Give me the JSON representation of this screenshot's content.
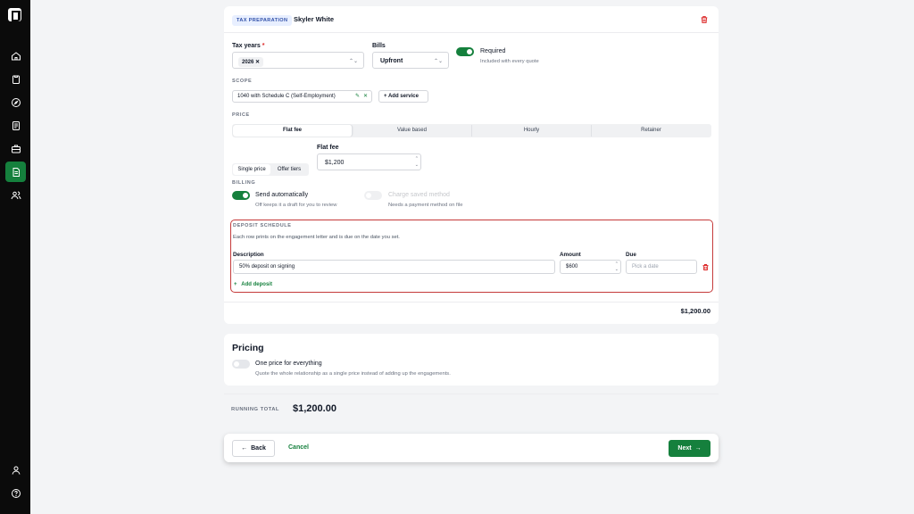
{
  "nav": {
    "items": [
      {
        "icon": "home-icon"
      },
      {
        "icon": "clipboard-icon"
      },
      {
        "icon": "compass-icon"
      },
      {
        "icon": "document-list-icon"
      },
      {
        "icon": "briefcase-icon"
      },
      {
        "icon": "proposal-document-icon",
        "active": true
      },
      {
        "icon": "users-icon"
      }
    ],
    "bottom": [
      {
        "icon": "user-icon"
      },
      {
        "icon": "help-icon"
      }
    ]
  },
  "engagement": {
    "badge": "TAX PREPARATION",
    "client": "Skyler White",
    "tax_years_label": "Tax years",
    "tax_years_required": "*",
    "tax_year_chip": "2026",
    "bills_label": "Bills",
    "bills_value": "Upfront",
    "required_label": "Required",
    "required_sub": "Included with every quote",
    "scope_label": "SCOPE",
    "scope_service": "1040 with Schedule C (Self-Employment)",
    "add_service": "Add service",
    "price_label": "PRICE",
    "price_tabs": [
      "Flat fee",
      "Value based",
      "Hourly",
      "Retainer"
    ],
    "price_tab_active": "Flat fee",
    "price_mode": [
      "Single price",
      "Offer tiers"
    ],
    "flat_fee_label": "Flat fee",
    "flat_fee_value": "$1,200",
    "billing_label": "BILLING",
    "send_auto_label": "Send automatically",
    "send_auto_sub": "Off keeps it a draft for you to review",
    "charge_label": "Charge saved method",
    "charge_sub": "Needs a payment method on file",
    "deposit": {
      "title": "DEPOSIT SCHEDULE",
      "desc": "Each row prints on the engagement letter and is due on the date you set.",
      "col_description": "Description",
      "col_amount": "Amount",
      "col_due": "Due",
      "row_description": "50% deposit on signing",
      "row_amount": "$600",
      "row_due_placeholder": "Pick a date",
      "add_label": "Add deposit"
    },
    "total": "$1,200.00"
  },
  "pricing": {
    "title": "Pricing",
    "toggle_label": "One price for everything",
    "toggle_sub": "Quote the whole relationship as a single price instead of adding up the engagements."
  },
  "running_total": {
    "label": "RUNNING TOTAL",
    "value": "$1,200.00"
  },
  "footer": {
    "back": "Back",
    "cancel": "Cancel",
    "next": "Next"
  },
  "colors": {
    "accent": "#15803d",
    "danger": "#dc2626",
    "badge_bg": "#e8efff",
    "highlight_border": "#c53a3a"
  }
}
